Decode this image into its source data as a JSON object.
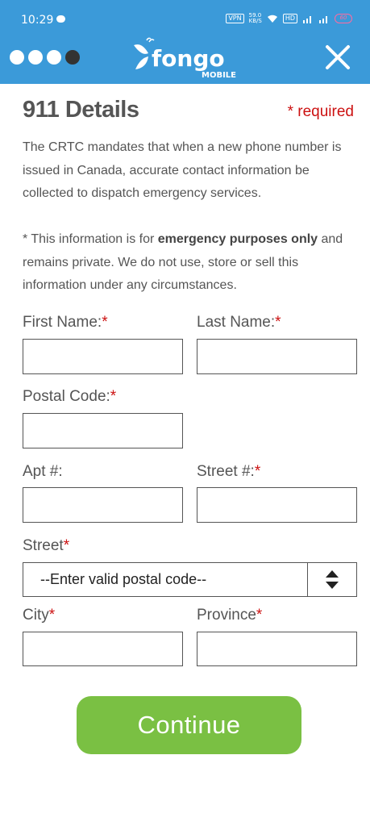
{
  "status_bar": {
    "time": "10:29",
    "vpn": "VPN",
    "speed_value": "59.0",
    "speed_unit": "KB/S",
    "hd": "HD",
    "battery": "60"
  },
  "header": {
    "dots_total": 4,
    "active_dot": 4,
    "logo_text": "fongo",
    "logo_subtext": "MOBILE",
    "close_icon": "close-icon",
    "background_color": "#3b9ad9"
  },
  "page": {
    "title": "911 Details",
    "required_note": "* required",
    "description": "The CRTC mandates that when a new phone number is issued in Canada, accurate contact information be collected to dispatch emergency services.",
    "privacy_prefix": "* This information is for ",
    "privacy_bold": "emergency purposes only",
    "privacy_suffix": " and remains private. We do not use, store or sell this information under any circumstances."
  },
  "form": {
    "first_name_label": "First Name:",
    "last_name_label": "Last Name:",
    "postal_code_label": "Postal Code:",
    "apt_label": "Apt #:",
    "street_num_label": "Street #:",
    "street_label": "Street",
    "street_select_value": "--Enter valid postal code--",
    "city_label": "City",
    "province_label": "Province",
    "required_mark": "*",
    "first_name_value": "",
    "last_name_value": "",
    "postal_code_value": "",
    "apt_value": "",
    "street_num_value": "",
    "city_value": "",
    "province_value": ""
  },
  "actions": {
    "continue_label": "Continue",
    "continue_color": "#7ac043"
  }
}
